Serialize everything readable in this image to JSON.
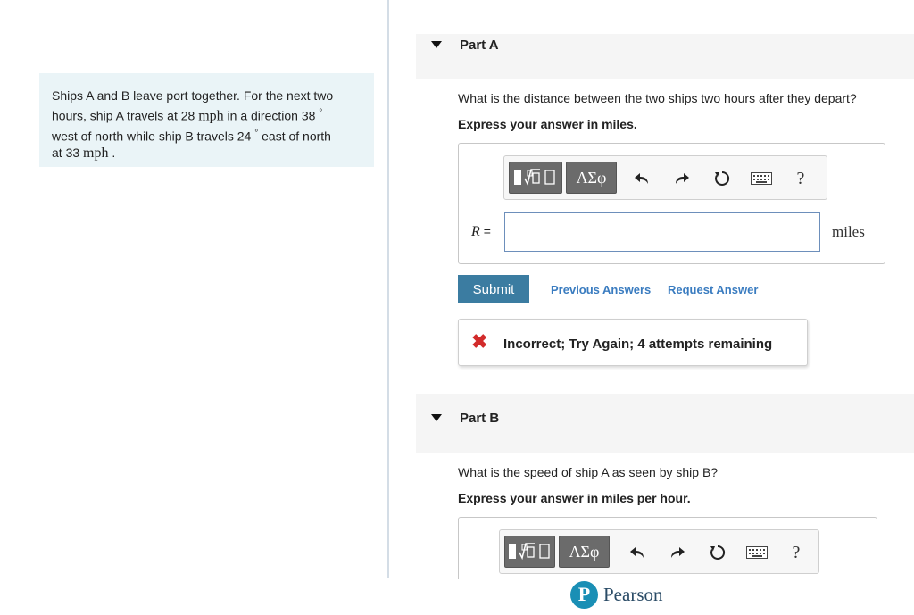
{
  "problem": {
    "line1": "Ships A and B leave port together. For the next two",
    "line2a": "hours, ship A travels at 28 ",
    "unit_a": "mph",
    "line2b": " in a direction 38",
    "degree": "°",
    "line3a": "west of north while ship B travels 24",
    "line3b": " east of north",
    "line4a": "at 33 ",
    "unit_b": "mph",
    "line4b": " ."
  },
  "part_a": {
    "title": "Part A",
    "question": "What is the distance between the two ships two hours after they depart?",
    "instruction": "Express your answer in miles.",
    "variable": "R",
    "equals": "=",
    "input_value": "",
    "unit": "miles",
    "submit_label": "Submit",
    "previous_answers_label": "Previous Answers",
    "request_answer_label": "Request Answer",
    "feedback_text": "Incorrect; Try Again; 4 attempts remaining"
  },
  "part_b": {
    "title": "Part B",
    "question": "What is the speed of ship A as seen by ship B?",
    "instruction": "Express your answer in miles per hour."
  },
  "toolbar": {
    "greek_label": "ΑΣφ",
    "help_label": "?",
    "icons": [
      "templates-icon",
      "greek-symbols-icon",
      "undo-icon",
      "redo-icon",
      "reset-icon",
      "keyboard-icon",
      "help-icon"
    ]
  },
  "footer": {
    "brand": "Pearson",
    "logo_letter": "P"
  },
  "colors": {
    "accent": "#3b7ca1",
    "link": "#3a7cc0",
    "error": "#d22b2b",
    "problem_bg": "#eaf4f7",
    "pearson": "#1a8fb5"
  }
}
